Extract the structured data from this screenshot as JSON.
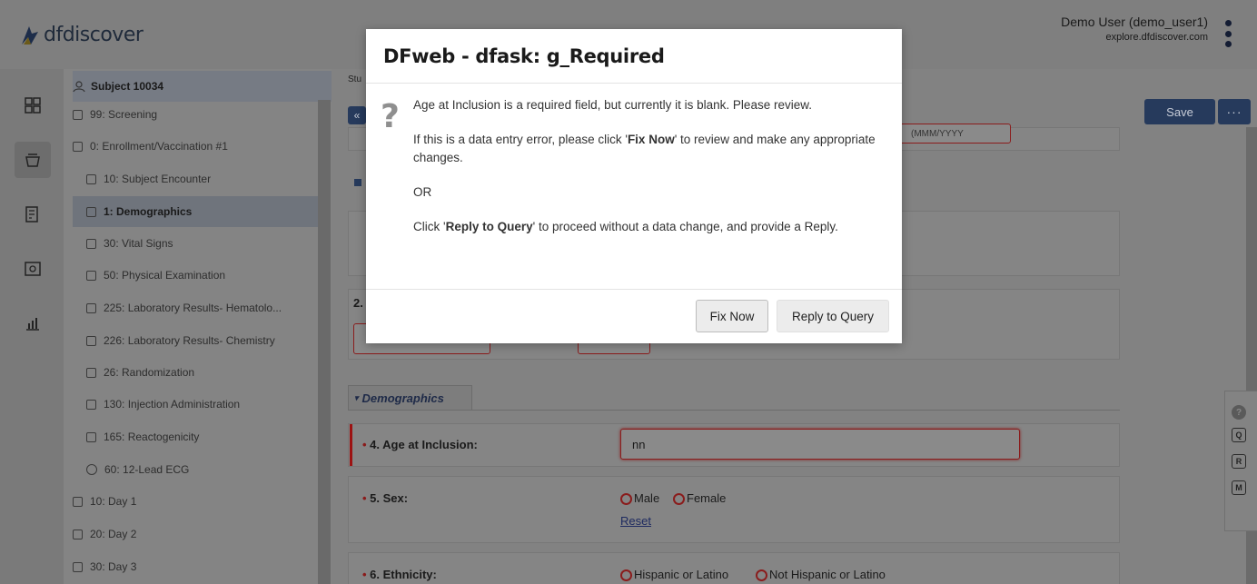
{
  "app": {
    "logo_text": "dfdiscover"
  },
  "user": {
    "name": "Demo User (demo_user1)",
    "host": "explore.dfdiscover.com"
  },
  "tree": {
    "subject": "Subject 10034",
    "items": [
      {
        "label": "99: Screening",
        "marker": "checkbox"
      },
      {
        "label": "0: Enrollment/Vaccination #1",
        "marker": "checkbox"
      },
      {
        "label": "10: Subject Encounter",
        "marker": "checkbox"
      },
      {
        "label": "1: Demographics",
        "marker": "checkbox"
      },
      {
        "label": "30: Vital Signs",
        "marker": "checkbox"
      },
      {
        "label": "50: Physical Examination",
        "marker": "checkbox"
      },
      {
        "label": "225: Laboratory Results- Hematolo...",
        "marker": "checkbox"
      },
      {
        "label": "226: Laboratory Results- Chemistry",
        "marker": "checkbox"
      },
      {
        "label": "26: Randomization",
        "marker": "checkbox"
      },
      {
        "label": "130: Injection Administration",
        "marker": "checkbox"
      },
      {
        "label": "165: Reactogenicity",
        "marker": "checkbox"
      },
      {
        "label": "60: 12-Lead ECG",
        "marker": "circle"
      },
      {
        "label": "10: Day 1",
        "marker": "checkbox"
      },
      {
        "label": "20: Day 2",
        "marker": "checkbox"
      },
      {
        "label": "30: Day 3",
        "marker": "checkbox"
      }
    ]
  },
  "main": {
    "crumb": "Stu",
    "save_label": "Save",
    "more_label": "···",
    "field2_number": "2.",
    "date_hint": "(MMM/YYYY",
    "section_title": "Demographics",
    "fields": {
      "age_label": "4. Age at Inclusion:",
      "age_value": "nn",
      "sex_label": "5. Sex:",
      "sex_options": [
        "Male",
        "Female"
      ],
      "reset_label": "Reset",
      "ethnicity_label": "6. Ethnicity:",
      "ethnicity_options": [
        "Hispanic or Latino",
        "Not Hispanic or Latino"
      ]
    },
    "side_buttons": [
      "Q",
      "R",
      "M"
    ]
  },
  "modal": {
    "title": "DFweb - dfask: g_Required",
    "icon": "question-mark",
    "line1": "Age at Inclusion is a required field, but currently it is blank. Please review.",
    "line2_pre": "If this is a data entry error, please click '",
    "line2_bold": "Fix Now",
    "line2_post": "' to review and make any appropriate changes.",
    "or": "OR",
    "line3_pre": "Click '",
    "line3_bold": "Reply to Query",
    "line3_post": "' to proceed without a data change, and provide a Reply.",
    "fix_button": "Fix Now",
    "reply_button": "Reply to Query"
  },
  "colors": {
    "accent": "#263a5c",
    "error": "#8a1c1c",
    "overlay": "#808080"
  }
}
